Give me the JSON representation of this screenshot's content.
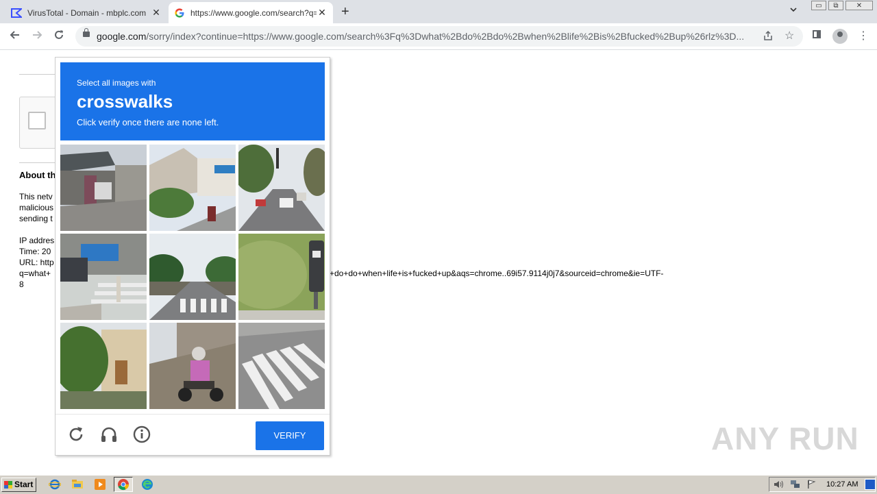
{
  "browser": {
    "tabs": [
      {
        "title": "VirusTotal - Domain - mbplc.com",
        "active": false
      },
      {
        "title": "https://www.google.com/search?q=",
        "active": true
      }
    ],
    "new_tab_glyph": "+",
    "close_glyph": "✕",
    "omnibox": {
      "host": "google.com",
      "path": "/sorry/index?continue=https://www.google.com/search%3Fq%3Dwhat%2Bdo%2Bdo%2Bwhen%2Blife%2Bis%2Bfucked%2Bup%26rlz%3D..."
    },
    "window_controls": [
      "▭",
      "⧉",
      "✕"
    ]
  },
  "page": {
    "about_heading": "About th",
    "para1": [
      "This netv",
      "malicious",
      "sending t"
    ],
    "ip_line": "IP addres",
    "time_line": "Time: 20",
    "url_line": "URL: http",
    "url_wrap_start": "q=what+",
    "url_wrap_end": "+do+do+when+life+is+fucked+up&aqs=chrome..69i57.9114j0j7&sourceid=chrome&ie=UTF-",
    "url_last": "8"
  },
  "captcha": {
    "instruction_small": "Select all images with",
    "target": "crosswalks",
    "instruction_sub": "Click verify once there are none left.",
    "verify_label": "VERIFY",
    "tiles": [
      "warehouse-street",
      "shop-street-motorbike",
      "traffic-road",
      "crosswalk-bollard-car",
      "crosswalk-road-palms",
      "parking-meter-grass",
      "building-trees",
      "motorcyclist-street",
      "crosswalk-stripes"
    ]
  },
  "watermark": "ANY RUN",
  "taskbar": {
    "start_label": "Start",
    "clock": "10:27 AM"
  }
}
